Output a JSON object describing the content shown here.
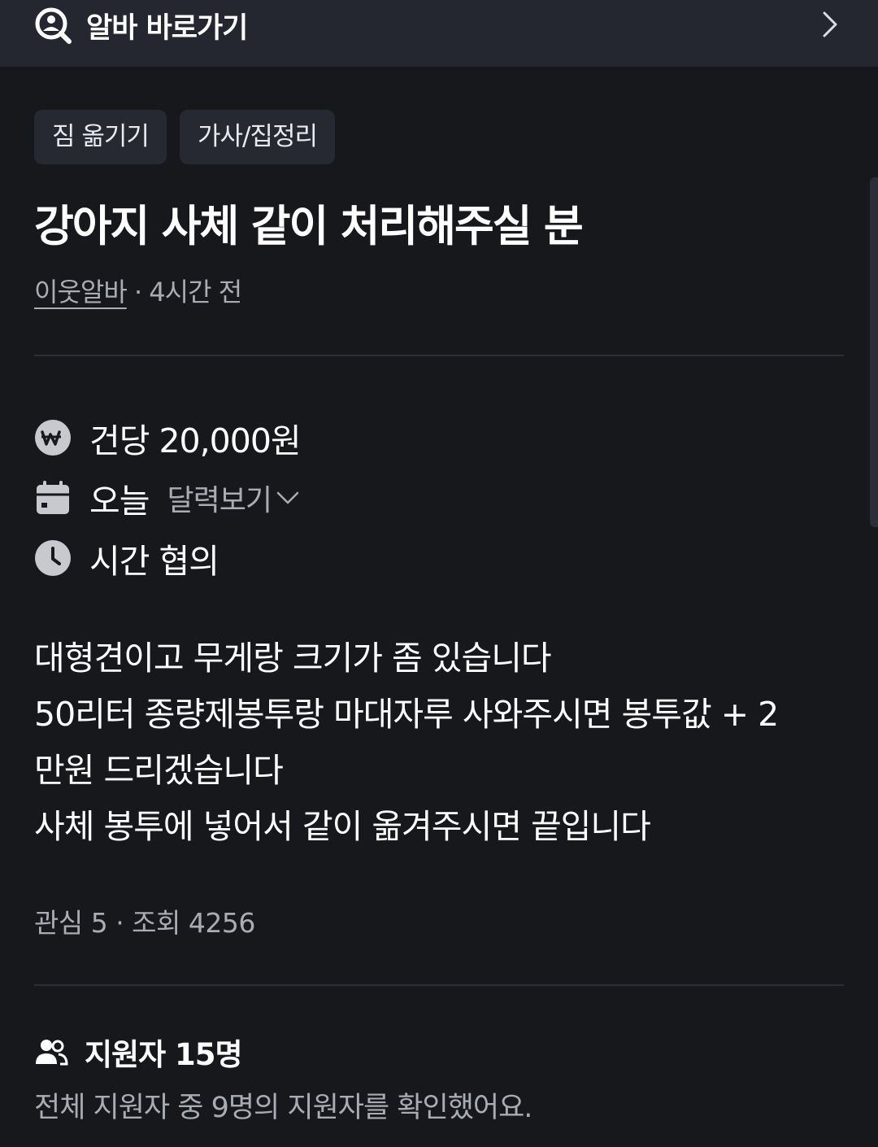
{
  "topbar": {
    "title": "알바 바로가기",
    "search_icon": "search-person-icon",
    "chevron_icon": "chevron-right-icon"
  },
  "tags": [
    "짐 옮기기",
    "가사/집정리"
  ],
  "post": {
    "title": "강아지 사체 같이 처리해주실 분",
    "author": "이웃알바",
    "separator": " · ",
    "time_ago": "4시간 전"
  },
  "info": {
    "pay": "건당 20,000원",
    "pay_icon": "won-icon",
    "date": "오늘",
    "calendar_link": "달력보기",
    "date_icon": "calendar-icon",
    "time": "시간 협의",
    "time_icon": "clock-icon"
  },
  "body_lines": [
    "대형견이고 무게랑 크기가 좀 있습니다",
    "50리터 종량제봉투랑 마대자루 사와주시면 봉투값 + 2",
    "만원 드리겠습니다",
    "사체 봉투에 넣어서 같이 옮겨주시면 끝입니다"
  ],
  "stats": "관심 5 · 조회 4256",
  "applicants": {
    "label": "지원자 15명",
    "note": "전체 지원자 중 9명의 지원자를 확인했어요.",
    "icon": "people-icon"
  },
  "colors": {
    "background": "#17181c",
    "topbar": "#242730",
    "tag_bg": "#262932",
    "muted_text": "#a9acb3"
  }
}
